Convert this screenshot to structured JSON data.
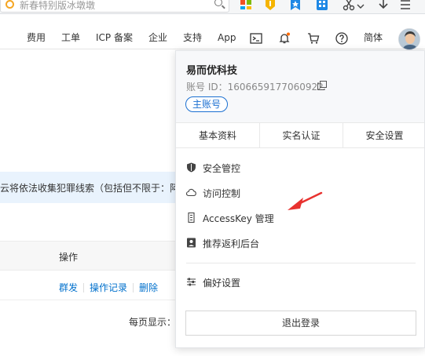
{
  "browser": {
    "omnibox_text": "新春特别版冰墩墩"
  },
  "header": {
    "nav_items": [
      {
        "label": "费用"
      },
      {
        "label": "工单"
      },
      {
        "label": "ICP 备案"
      },
      {
        "label": "企业"
      },
      {
        "label": "支持"
      },
      {
        "label": "App"
      }
    ],
    "language": "简体",
    "icons": [
      "terminal-icon",
      "bell-icon",
      "cart-icon",
      "help-icon"
    ],
    "notification_dot_color": "#ff6a00"
  },
  "page": {
    "notice_text": "云将依法收集犯罪线索（包括但不限于：阿",
    "table_header_ops": "操作",
    "row_actions": [
      "群发",
      "操作记录",
      "删除"
    ],
    "per_page_label": "每页显示："
  },
  "account_panel": {
    "company_name": "易而优科技",
    "account_id": "账号 ID：1606659177060922",
    "badge": "主账号",
    "tabs": [
      "基本资料",
      "实名认证",
      "安全设置"
    ],
    "menu": [
      {
        "label": "安全管控",
        "icon": "shield-icon"
      },
      {
        "label": "访问控制",
        "icon": "cloud-icon"
      },
      {
        "label": "AccessKey 管理",
        "icon": "key-icon"
      },
      {
        "label": "推荐返利后台",
        "icon": "rebate-icon"
      }
    ],
    "preferences": {
      "label": "偏好设置",
      "icon": "sliders-icon"
    },
    "logout": "退出登录"
  },
  "colors": {
    "accent_blue": "#1a6fd1",
    "link_blue": "#0070cc",
    "annotation_red": "#e8322f",
    "notice_bg": "#e9f3fd"
  }
}
